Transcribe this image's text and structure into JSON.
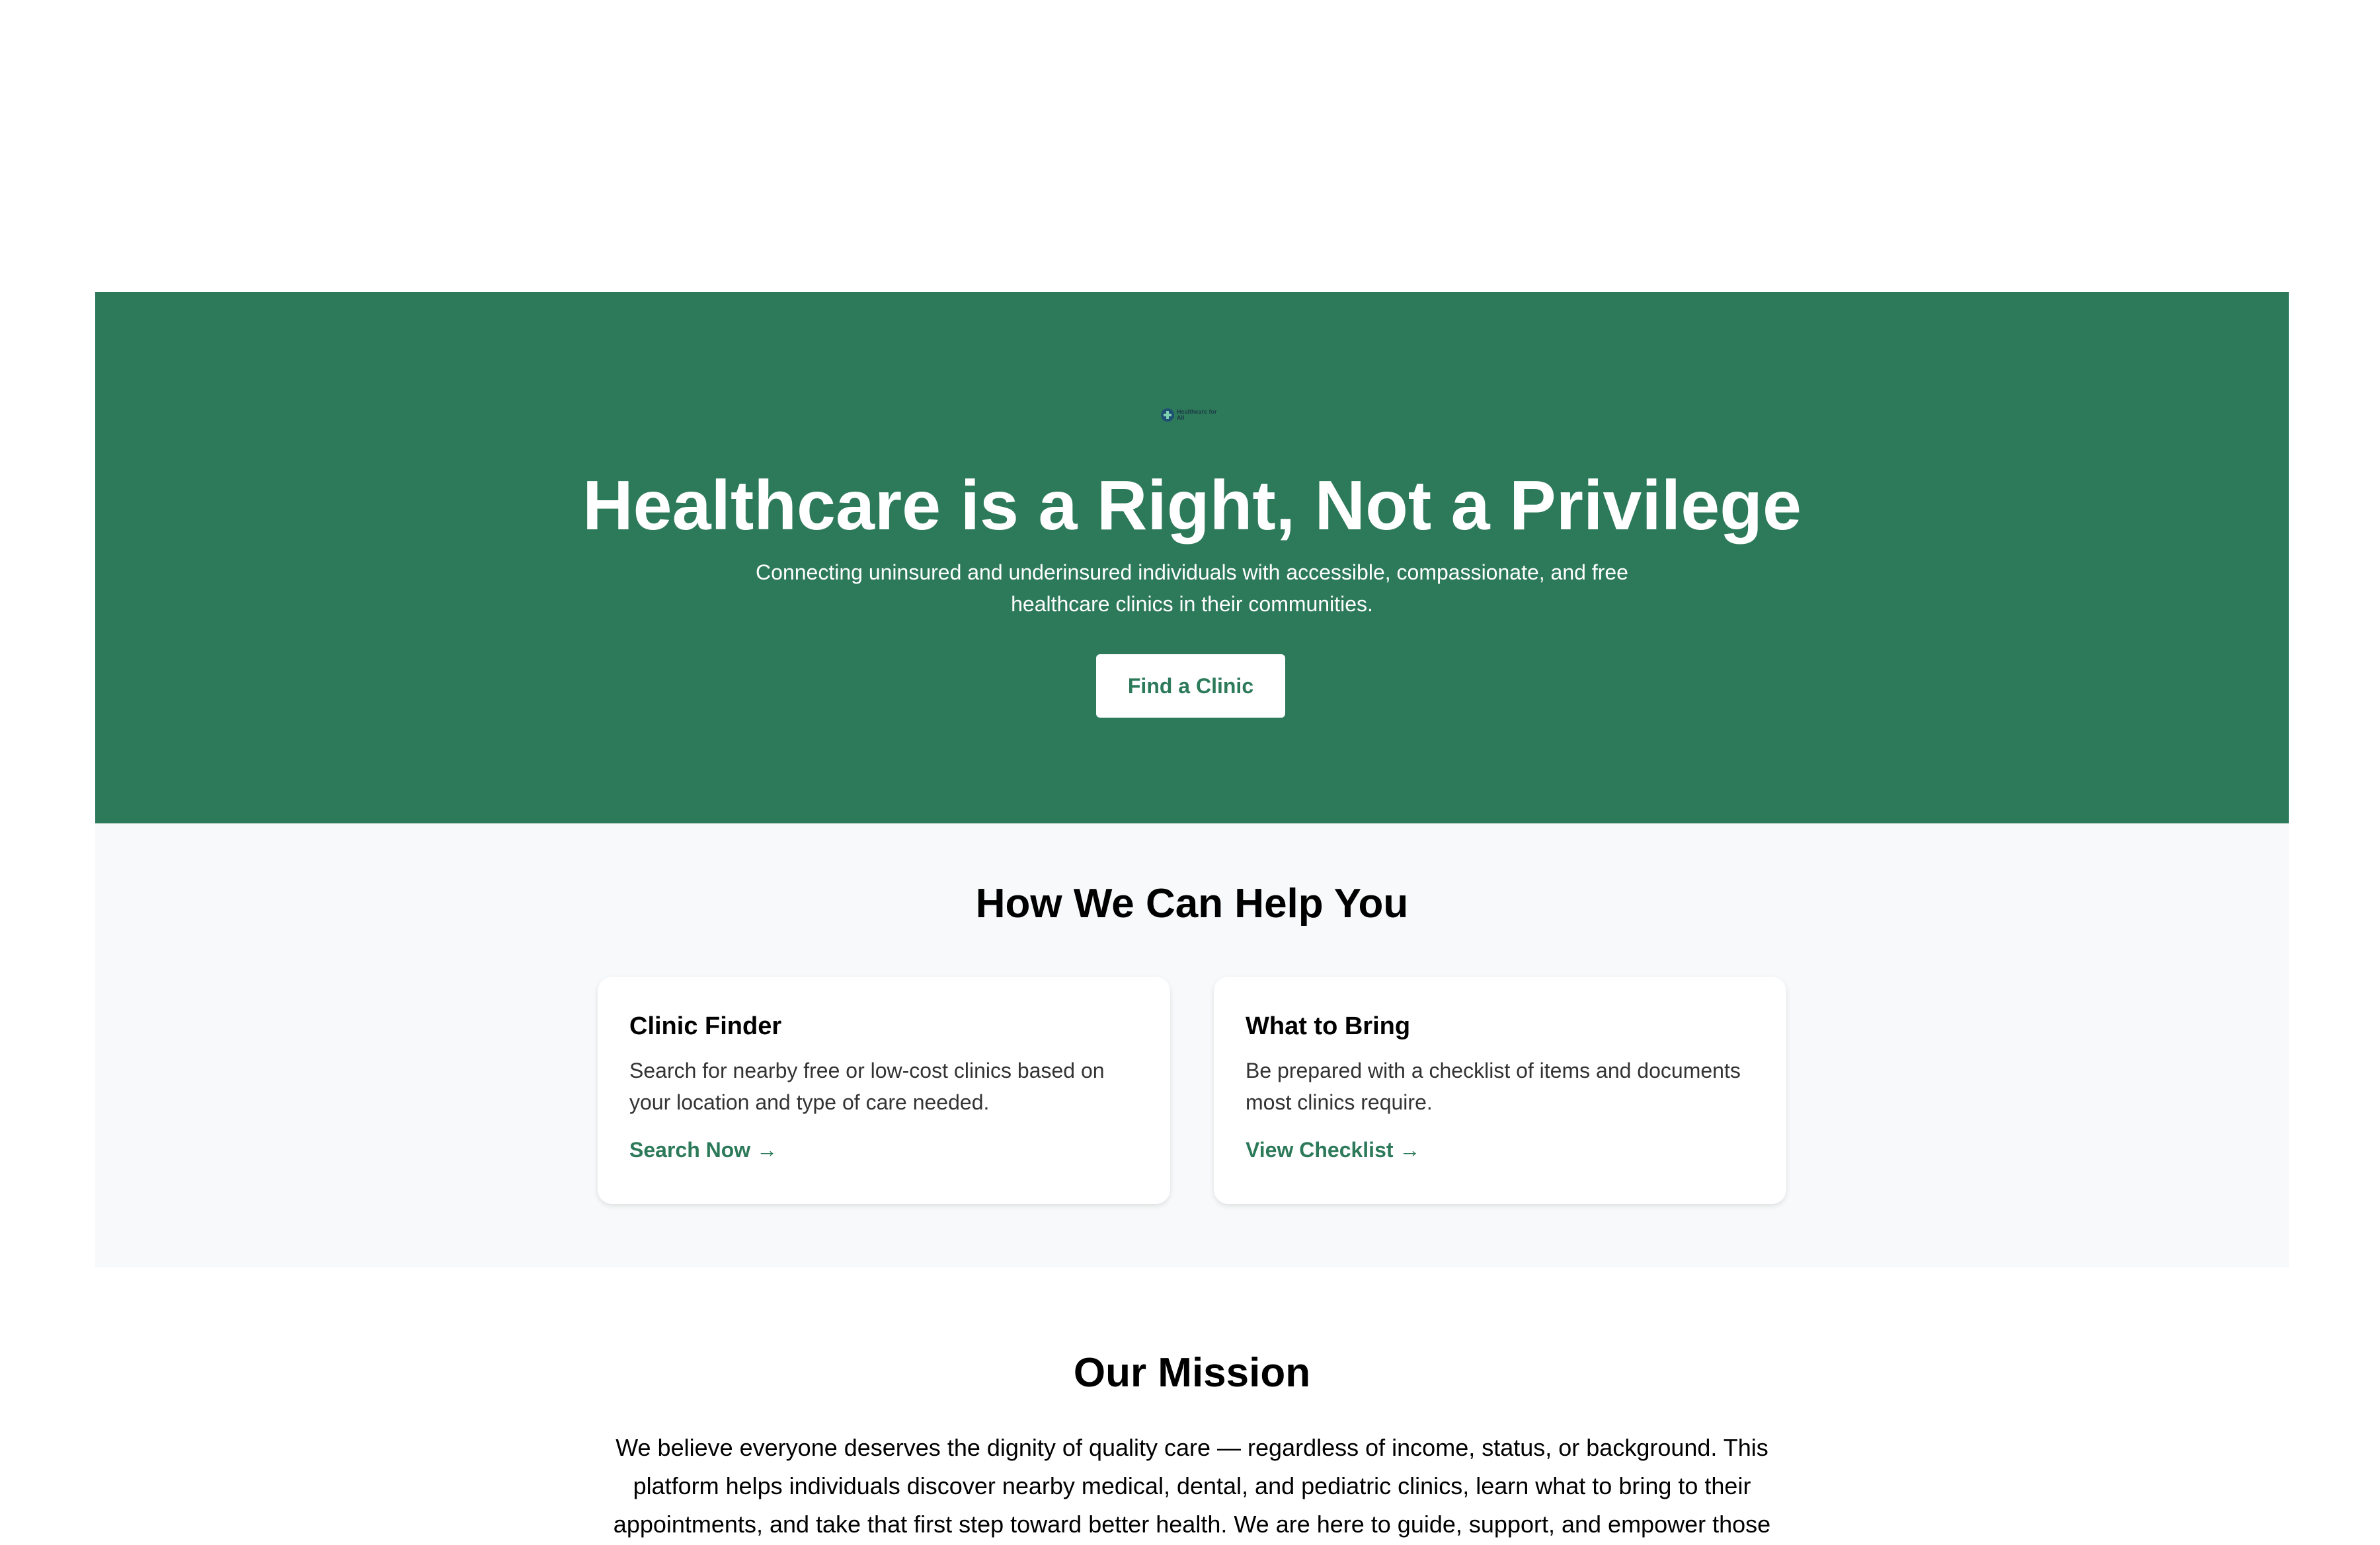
{
  "logo": {
    "text": "Healthcare for All",
    "icon": "medical-cross-icon"
  },
  "hero": {
    "title": "Healthcare is a Right, Not a Privilege",
    "subtitle": "Connecting uninsured and underinsured individuals with accessible, compassionate, and free healthcare clinics in their communities.",
    "button_label": "Find a Clinic"
  },
  "help": {
    "title": "How We Can Help You",
    "cards": [
      {
        "title": "Clinic Finder",
        "description": "Search for nearby free or low-cost clinics based on your location and type of care needed.",
        "link_label": "Search Now →"
      },
      {
        "title": "What to Bring",
        "description": "Be prepared with a checklist of items and documents most clinics require.",
        "link_label": "View Checklist →"
      }
    ]
  },
  "mission": {
    "title": "Our Mission",
    "text": "We believe everyone deserves the dignity of quality care — regardless of income, status, or background. This platform helps individuals discover nearby medical, dental, and pediatric clinics, learn what to bring to their appointments, and take that first step toward better health. We are here to guide, support, and empower those"
  },
  "colors": {
    "brand_green": "#2d7a5b",
    "section_background": "#f7f9fa",
    "white": "#ffffff"
  }
}
